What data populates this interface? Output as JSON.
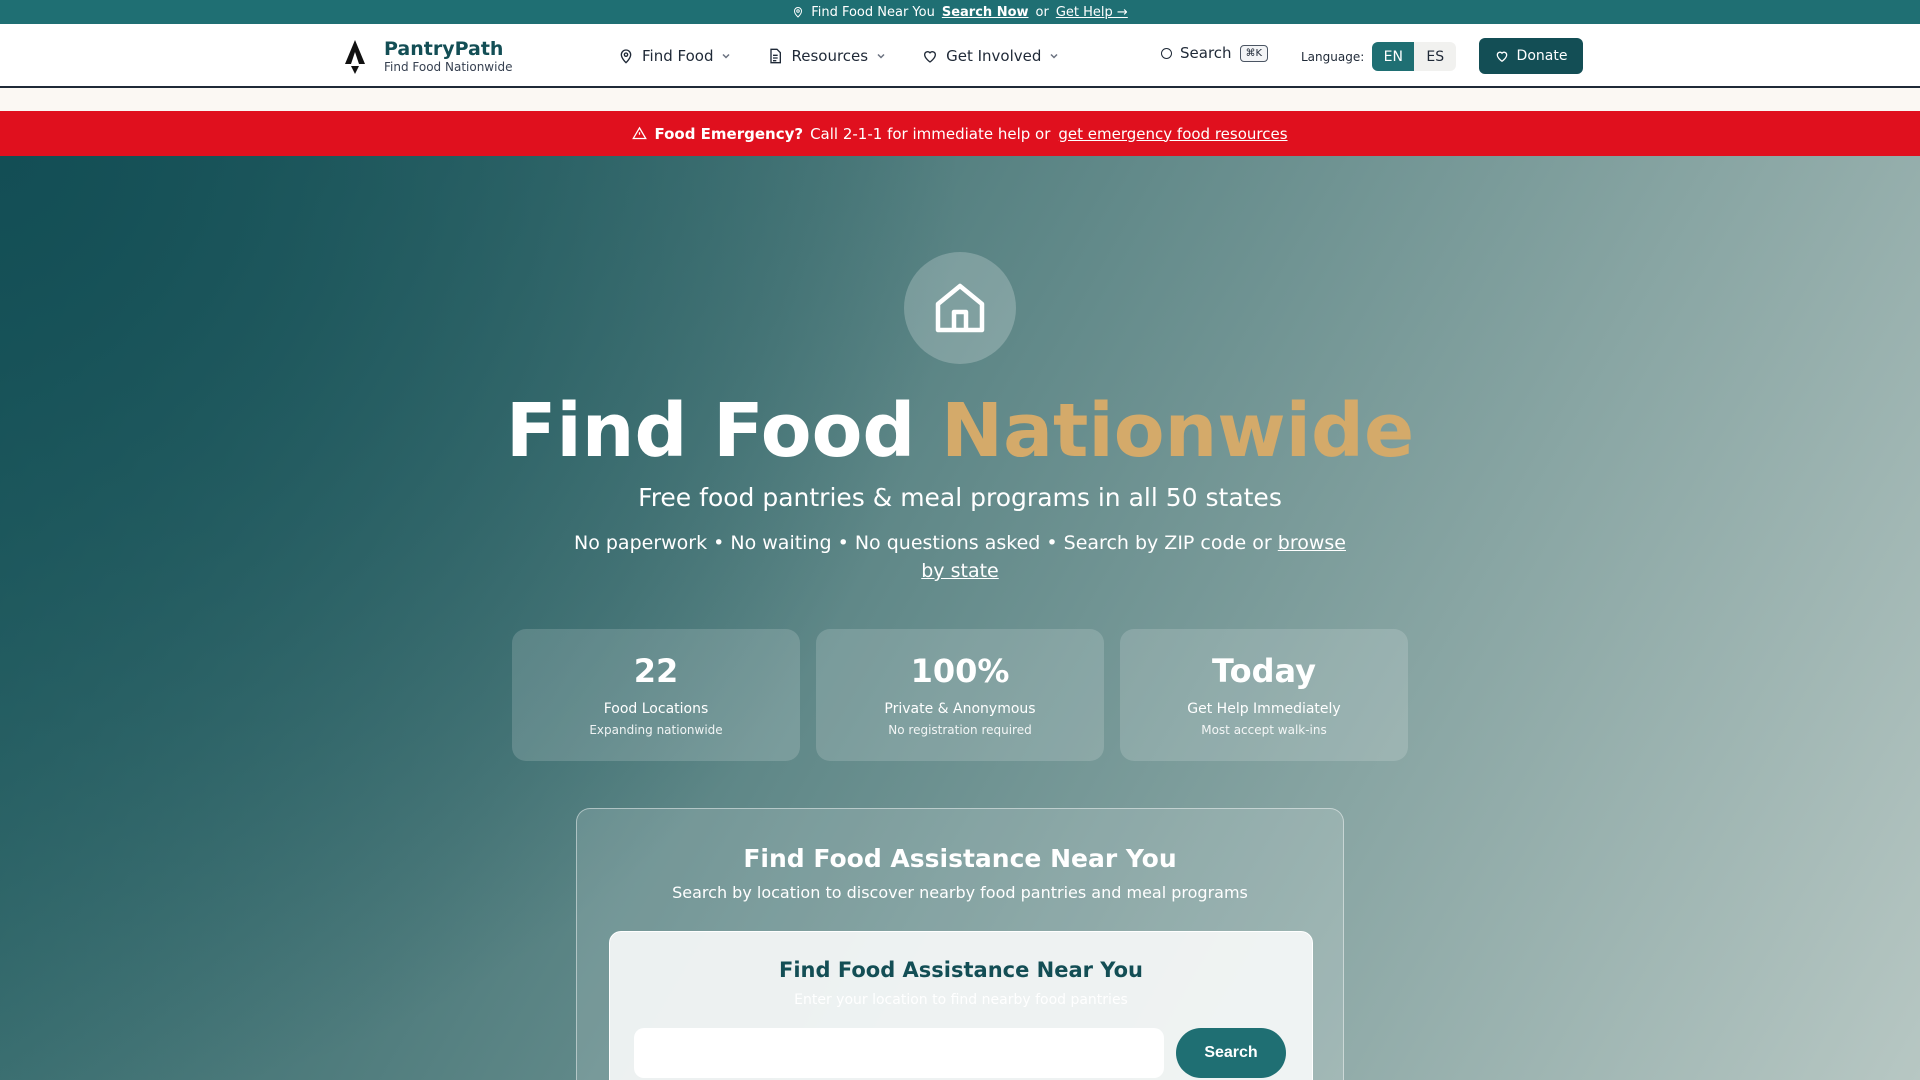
{
  "topbar": {
    "icon": "map-pin-icon",
    "text": "Find Food Near You",
    "search_link": "Search Now",
    "or": "or",
    "help_link": "Get Help →"
  },
  "header": {
    "brand_name": "PantryPath",
    "brand_tagline": "Find Food Nationwide",
    "logo_icon": "rocket-logo-icon",
    "nav": [
      {
        "label": "Find Food",
        "icon": "map-pin-icon"
      },
      {
        "label": "Resources",
        "icon": "document-icon"
      },
      {
        "label": "Get Involved",
        "icon": "heart-icon"
      }
    ],
    "search_label": "Search",
    "search_shortcut": "⌘K",
    "language_label": "Language:",
    "languages": [
      "EN",
      "ES"
    ],
    "active_language": "EN",
    "donate_label": "Donate"
  },
  "emergency": {
    "icon": "warning-triangle-icon",
    "bold": "Food Emergency?",
    "text": "Call 2-1-1 for immediate help or",
    "link": "get emergency food resources"
  },
  "hero": {
    "icon": "house-icon",
    "title_main": "Find Food",
    "title_accent": "Nationwide",
    "subtitle": "Free food pantries & meal programs in all 50 states",
    "desc": "No paperwork • No waiting • No questions asked • Search by ZIP code or",
    "desc_link": "browse by state",
    "stats": [
      {
        "value": "22",
        "label": "Food Locations",
        "note": "Expanding nationwide"
      },
      {
        "value": "100%",
        "label": "Private & Anonymous",
        "note": "No registration required"
      },
      {
        "value": "Today",
        "label": "Get Help Immediately",
        "note": "Most accept walk-ins"
      }
    ]
  },
  "search_panel": {
    "title": "Find Food Assistance Near You",
    "subtitle": "Search by location to discover nearby food pantries and meal programs",
    "card_title": "Find Food Assistance Near You",
    "card_subtitle": "Enter your location to find nearby food pantries",
    "input_value": "",
    "button_label": "Search"
  },
  "colors": {
    "brand_teal": "#1f6f73",
    "brand_dark": "#134e55",
    "accent_gold": "#d4aa6a",
    "emergency_red": "#e0101e"
  }
}
